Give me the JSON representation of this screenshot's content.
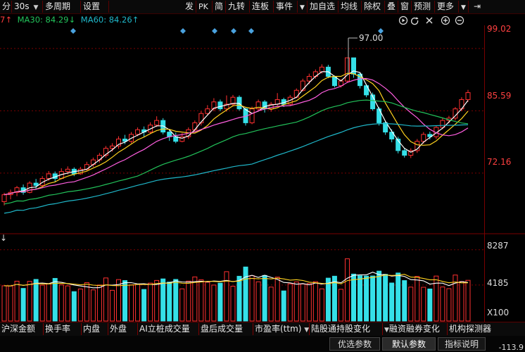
{
  "toolbar": {
    "items": [
      {
        "label": "分"
      },
      {
        "label": "30s"
      },
      {
        "label": "多周期"
      },
      {
        "label": "设置"
      },
      {
        "label": "发"
      },
      {
        "label": "PK"
      },
      {
        "label": "简"
      },
      {
        "label": "九转"
      },
      {
        "label": "连板"
      },
      {
        "label": "事件"
      },
      {
        "label": "加自选"
      },
      {
        "label": "均线"
      },
      {
        "label": "除权"
      },
      {
        "label": "叠"
      },
      {
        "label": "窗"
      },
      {
        "label": "预测"
      },
      {
        "label": "更多"
      }
    ],
    "icons": [
      "dropdown-caret-icon",
      "dropdown-icon",
      "collapse-icon"
    ],
    "ctrl_icons": [
      "play-icon",
      "refresh-icon",
      "close-icon",
      "zoom-in-icon",
      "zoom-out-icon"
    ]
  },
  "ma": {
    "prefix": "7↑",
    "ma30": "MA30: 84.29↓",
    "ma60": "MA60: 84.26↑"
  },
  "price_axis": {
    "top": "99.02",
    "mid": "85.59",
    "low": "72.16"
  },
  "peak_label": "97.00",
  "volume_axis": {
    "top": "8287",
    "mid": "4185",
    "unit": "X100"
  },
  "volume_arrow": "↓",
  "tabs": [
    {
      "label": "沪深金额"
    },
    {
      "label": "换手率"
    },
    {
      "label": "内盘"
    },
    {
      "label": "外盘"
    },
    {
      "label": "AI立桩成交量"
    },
    {
      "label": "盘后成交量"
    },
    {
      "label": "市盈率(ttm)"
    },
    {
      "label": "陆股通持股变化"
    },
    {
      "label": "融资融券变化"
    },
    {
      "label": "机构探测器"
    }
  ],
  "bottom_buttons": [
    {
      "label": "优选参数"
    },
    {
      "label": "默认参数"
    },
    {
      "label": "指标说明"
    }
  ],
  "bottom_value": "113.9",
  "colors": {
    "up": "#ff3030",
    "down": "#35e0e8",
    "ma_white": "#ffffff",
    "ma_yellow": "#ffd21e",
    "ma_pink": "#ff5ee0",
    "ma_green": "#22c25a",
    "ma_cyan": "#1fb7c9",
    "grid": "#7a0000"
  },
  "chart_data": {
    "type": "candlestick",
    "y_range": [
      60,
      104
    ],
    "y_ticks": [
      "99.02",
      "85.59",
      "72.16"
    ],
    "peak": "97.00",
    "candles": [
      [
        66,
        67.5,
        65.2,
        67.9
      ],
      [
        67.5,
        68,
        66.5,
        68.6
      ],
      [
        68,
        69,
        67.2,
        69.4
      ],
      [
        69,
        68,
        67.5,
        69.7
      ],
      [
        68,
        70,
        67.8,
        70.4
      ],
      [
        70,
        69.5,
        68.6,
        70.9
      ],
      [
        69.5,
        71,
        69,
        71.5
      ],
      [
        71,
        72,
        70.5,
        72.6
      ],
      [
        72,
        71,
        70.2,
        72.5
      ],
      [
        71,
        72.5,
        70.8,
        73.2
      ],
      [
        72.5,
        73,
        71.9,
        73.6
      ],
      [
        73,
        72,
        71.5,
        73.4
      ],
      [
        72,
        73,
        71.8,
        73.5
      ],
      [
        73,
        74,
        72.6,
        74.6
      ],
      [
        74,
        75,
        73.5,
        75.5
      ],
      [
        75,
        76,
        74.4,
        76.5
      ],
      [
        76,
        77.5,
        75.5,
        78
      ],
      [
        77.5,
        78,
        76.8,
        78.6
      ],
      [
        78,
        79.5,
        77.4,
        80.1
      ],
      [
        79.5,
        79,
        78.4,
        80.4
      ],
      [
        79,
        80.5,
        78.6,
        81
      ],
      [
        80.5,
        81.5,
        80.1,
        82
      ],
      [
        81.5,
        81,
        80,
        82.2
      ],
      [
        81,
        82.5,
        80.6,
        83.1
      ],
      [
        82.5,
        83.5,
        82.1,
        84.4
      ],
      [
        83.5,
        81,
        80.5,
        84
      ],
      [
        81,
        80,
        79.1,
        81.6
      ],
      [
        80,
        79,
        78.6,
        80.9
      ],
      [
        79,
        80,
        78.8,
        80.8
      ],
      [
        80,
        81.5,
        79.5,
        82
      ],
      [
        81.5,
        83,
        81,
        83.5
      ],
      [
        83,
        85,
        82.4,
        85.5
      ],
      [
        85,
        86,
        84.6,
        86.8
      ],
      [
        86,
        87.5,
        85.5,
        88.3
      ],
      [
        87.5,
        86,
        85.5,
        88
      ],
      [
        86,
        87,
        85.4,
        88.9
      ],
      [
        87,
        88.5,
        86.5,
        89
      ],
      [
        88.5,
        86,
        85.6,
        88.9
      ],
      [
        86,
        83,
        82.4,
        86.4
      ],
      [
        83,
        86,
        82.7,
        86.5
      ],
      [
        86,
        87.5,
        85.6,
        88
      ],
      [
        87.5,
        86,
        85.2,
        87.9
      ],
      [
        86,
        87,
        85.4,
        87.5
      ],
      [
        87,
        88,
        86.5,
        89.4
      ],
      [
        88,
        87,
        86.4,
        88.4
      ],
      [
        87,
        88.5,
        86.6,
        89
      ],
      [
        88.5,
        90,
        88.3,
        90.4
      ],
      [
        90,
        92,
        89.7,
        92.5
      ],
      [
        92,
        93,
        91.3,
        93.6
      ],
      [
        93,
        94,
        92.5,
        94.5
      ],
      [
        94,
        95,
        93.6,
        95.6
      ],
      [
        95,
        93,
        92.6,
        95.5
      ],
      [
        93,
        91,
        90.6,
        93.2
      ],
      [
        91,
        92,
        90.6,
        92.4
      ],
      [
        92,
        97,
        91.6,
        97
      ],
      [
        97,
        93.5,
        92.7,
        97
      ],
      [
        93.5,
        91,
        90.4,
        93.9
      ],
      [
        91,
        89,
        88.5,
        91.4
      ],
      [
        89,
        86,
        85.6,
        89.5
      ],
      [
        86,
        83,
        82.4,
        86.4
      ],
      [
        83,
        81,
        80.4,
        83.4
      ],
      [
        81,
        79.5,
        78.8,
        81.6
      ],
      [
        79.5,
        77,
        76.4,
        80
      ],
      [
        77,
        76,
        75.5,
        77.5
      ],
      [
        76,
        77,
        75.4,
        77.5
      ],
      [
        77,
        79,
        76.5,
        79.5
      ],
      [
        79,
        80.5,
        78.5,
        81
      ],
      [
        80.5,
        80,
        79.4,
        81.1
      ],
      [
        80,
        82,
        79.5,
        82.4
      ],
      [
        82,
        83.5,
        81.6,
        84
      ],
      [
        83.5,
        84,
        82.9,
        84.5
      ],
      [
        84,
        86,
        83.5,
        86.4
      ],
      [
        86,
        88,
        85.5,
        88.5
      ],
      [
        88,
        89.5,
        87.5,
        90.1
      ]
    ],
    "volume_y_range": [
      0,
      9000
    ],
    "volume_ticks": [
      "8287",
      "4185",
      "X100"
    ],
    "volume_unit": "X100"
  }
}
